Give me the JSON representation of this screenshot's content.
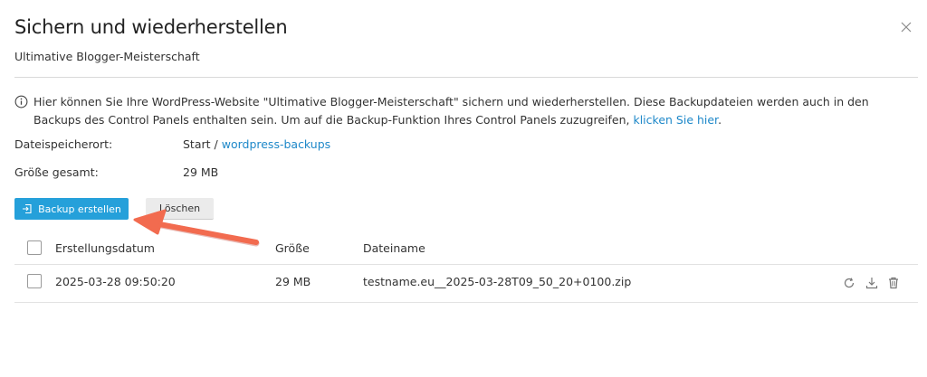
{
  "dialog": {
    "title": "Sichern und wiederherstellen",
    "subtitle": "Ultimative Blogger-Meisterschaft",
    "close_icon": "close-icon"
  },
  "info": {
    "icon": "info-icon",
    "text": "Hier können Sie Ihre WordPress-Website \"Ultimative Blogger-Meisterschaft\" sichern und wiederherstellen. Diese Backupdateien werden auch in den Backups des Control Panels enthalten sein. Um auf die Backup-Funktion Ihres Control Panels zuzugreifen,",
    "link_label": "klicken Sie hier",
    "trailing": "."
  },
  "location": {
    "label": "Dateispeicherort:",
    "root": "Start",
    "separator": " / ",
    "folder_link": "wordpress-backups"
  },
  "size": {
    "label": "Größe gesamt:",
    "value": "29 MB"
  },
  "toolbar": {
    "create_label": "Backup erstellen",
    "delete_label": "Löschen"
  },
  "table": {
    "columns": [
      "Erstellungsdatum",
      "Größe",
      "Dateiname"
    ],
    "rows": [
      {
        "date": "2025-03-28 09:50:20",
        "size": "29 MB",
        "filename": "testname.eu__2025-03-28T09_50_20+0100.zip",
        "actions": [
          "restore-icon",
          "download-icon",
          "trash-icon"
        ]
      }
    ]
  },
  "colors": {
    "primary": "#25a0da",
    "link": "#1e88c9",
    "annotation_arrow": "#f26b4f"
  }
}
